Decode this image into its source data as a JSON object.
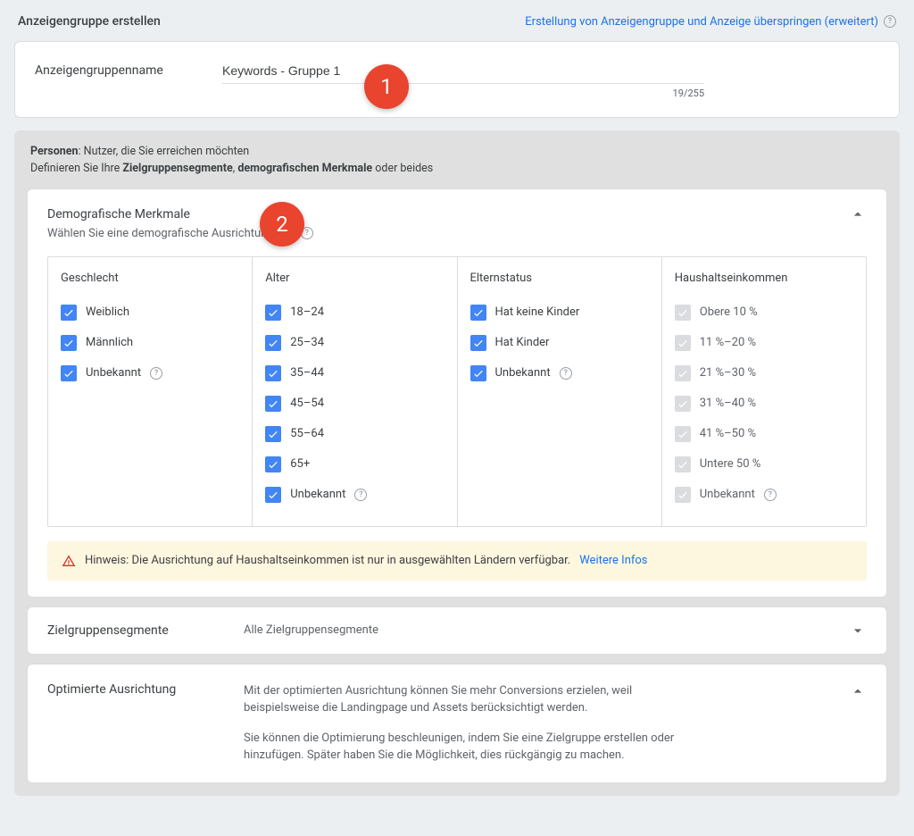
{
  "header": {
    "title": "Anzeigengruppe erstellen",
    "skip_link": "Erstellung von Anzeigengruppe und Anzeige überspringen (erweitert)"
  },
  "adgroup": {
    "label": "Anzeigengruppenname",
    "value": "Keywords - Gruppe 1",
    "count": "19/255"
  },
  "people": {
    "line1_bold": "Personen",
    "line1_rest": ": Nutzer, die Sie erreichen möchten",
    "line2_prefix": "Definieren Sie Ihre ",
    "line2_b1": "Zielgruppensegmente",
    "line2_sep": ", ",
    "line2_b2": "demografischen Merkmale",
    "line2_suffix": " oder beides"
  },
  "demographics": {
    "title": "Demografische Merkmale",
    "desc": "Wählen Sie eine demografische Ausrichtung aus",
    "columns": {
      "gender": {
        "title": "Geschlecht",
        "items": [
          "Weiblich",
          "Männlich",
          "Unbekannt"
        ]
      },
      "age": {
        "title": "Alter",
        "items": [
          "18–24",
          "25–34",
          "35–44",
          "45–54",
          "55–64",
          "65+",
          "Unbekannt"
        ]
      },
      "parent": {
        "title": "Elternstatus",
        "items": [
          "Hat keine Kinder",
          "Hat Kinder",
          "Unbekannt"
        ]
      },
      "income": {
        "title": "Haushaltseinkommen",
        "items": [
          "Obere 10 %",
          "11 %–20 %",
          "21 %–30 %",
          "31 %–40 %",
          "41 %–50 %",
          "Untere 50 %",
          "Unbekannt"
        ]
      }
    },
    "note": {
      "text": "Hinweis: Die Ausrichtung auf Haushaltseinkommen ist nur in ausgewählten Ländern verfügbar.",
      "link": "Weitere Infos"
    }
  },
  "audiences": {
    "title": "Zielgruppensegmente",
    "value": "Alle Zielgruppensegmente"
  },
  "optimized": {
    "title": "Optimierte Ausrichtung",
    "p1": "Mit der optimierten Ausrichtung können Sie mehr Conversions erzielen, weil beispielsweise die Landingpage und Assets berücksichtigt werden.",
    "p2": "Sie können die Optimierung beschleunigen, indem Sie eine Zielgruppe erstellen oder hinzufügen. Später haben Sie die Möglichkeit, dies rückgängig zu machen."
  },
  "callouts": {
    "c1": "1",
    "c2": "2"
  }
}
